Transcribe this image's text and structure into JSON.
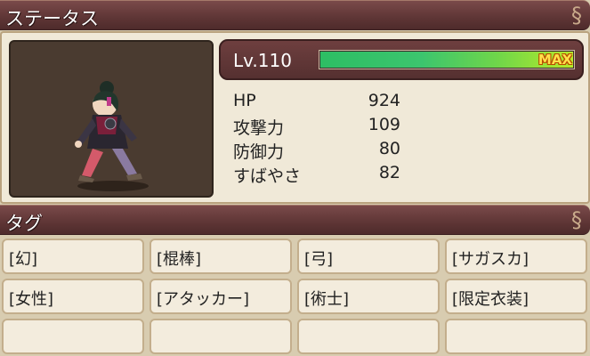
{
  "status_header": {
    "title": "ステータス"
  },
  "level": {
    "label": "Lv.110",
    "progress": 1.0,
    "badge": "MAX"
  },
  "stats": [
    {
      "label": "HP",
      "value": "924"
    },
    {
      "label": "攻撃力",
      "value": "109"
    },
    {
      "label": "防御力",
      "value": "80"
    },
    {
      "label": "すばやさ",
      "value": "82"
    }
  ],
  "tags_header": {
    "title": "タグ"
  },
  "tags": [
    [
      "[幻]",
      "[棍棒]",
      "[弓]",
      "[サガスカ]"
    ],
    [
      "[女性]",
      "[アタッカー]",
      "[術士]",
      "[限定衣装]"
    ],
    [
      "",
      "",
      "",
      ""
    ]
  ],
  "colors": {
    "banner": "#5e3535",
    "gauge_fill": "#3cc56e",
    "max_badge": "#ffe04a",
    "panel": "#f0e9d8"
  },
  "icons": {
    "banner_ornament": "swirl-ornament-icon"
  }
}
